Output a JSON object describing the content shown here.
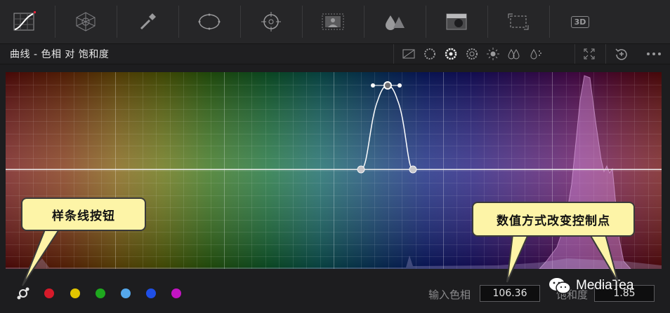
{
  "toolbar": {
    "tools": [
      {
        "icon": "curves-icon",
        "active": true
      },
      {
        "icon": "color-warper-icon"
      },
      {
        "icon": "qualifier-eyedropper-icon"
      },
      {
        "icon": "window-icon"
      },
      {
        "icon": "tracker-icon"
      },
      {
        "icon": "magic-mask-icon"
      },
      {
        "icon": "blur-icon"
      },
      {
        "icon": "key-icon"
      },
      {
        "icon": "sizing-icon"
      },
      {
        "icon": "3d-icon",
        "text": "3D"
      }
    ]
  },
  "panel": {
    "title": "曲线 - 色相 对 饱和度",
    "mode_icons": [
      "custom-curve-icon",
      "hue-vs-hue-icon",
      "hue-vs-sat-icon",
      "hue-vs-lum-icon",
      "lum-vs-sat-icon",
      "sat-vs-sat-icon",
      "sat-vs-lum-icon"
    ],
    "active_mode": "hue-vs-sat-icon",
    "right_icons": [
      "expand-icon",
      "reset-icon",
      "more-options-icon"
    ]
  },
  "colors": {
    "callout_bg": "#fdf4a7",
    "curve": "#ffffff",
    "dot_red": "#d61a2a",
    "dot_yellow": "#e2c500",
    "dot_green": "#1ea81e",
    "dot_cyan": "#55a8ec",
    "dot_blue": "#1f4fe6",
    "dot_magenta": "#c314c3"
  },
  "swatches": [
    "red",
    "yellow",
    "green",
    "cyan",
    "blue",
    "magenta"
  ],
  "bottom": {
    "input_hue_label": "输入色相",
    "input_hue_value": "106.36",
    "saturation_label": "饱和度",
    "saturation_value": "1.85"
  },
  "callouts": {
    "spline": "样条线按钮",
    "numeric": "数值方式改变控制点"
  },
  "watermark": "MediaTea"
}
